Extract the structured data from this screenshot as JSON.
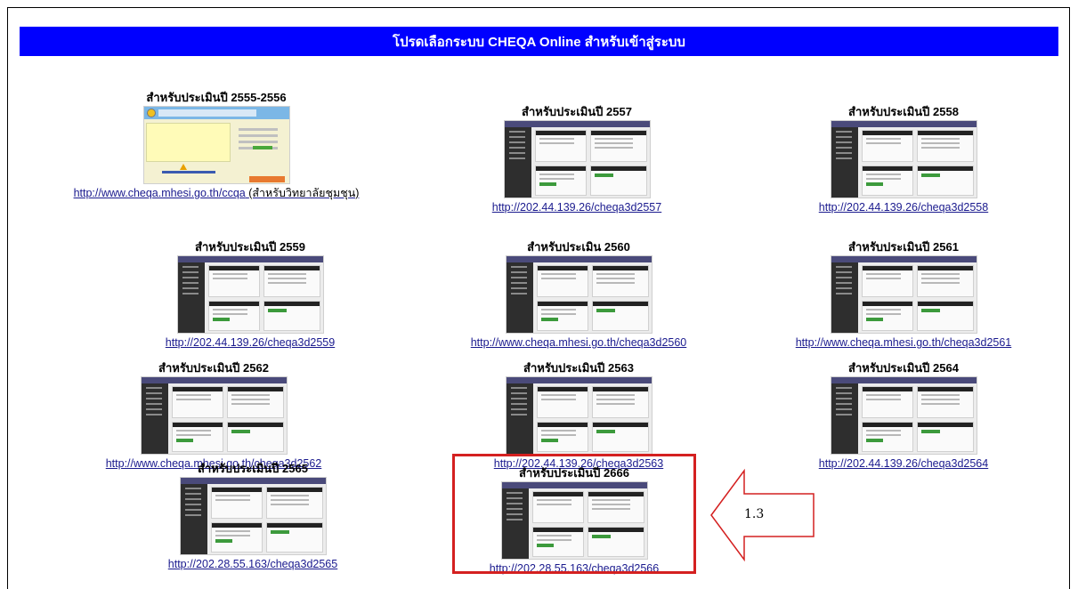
{
  "banner": {
    "text": "โปรดเลือกระบบ CHEQA Online สำหรับเข้าสู่ระบบ",
    "color": "#0000ff"
  },
  "items": [
    {
      "title": "สำหรับประเมินปี 2555-2556",
      "link": "http://www.cheqa.mhesi.go.th/ccqa",
      "link_suffix": "(สำหรับวิทยาลัยชุมชุน)"
    },
    {
      "title": "สำหรับประเมินปี 2557",
      "link": "http://202.44.139.26/cheqa3d2557"
    },
    {
      "title": "สำหรับประเมินปี 2558",
      "link": "http://202.44.139.26/cheqa3d2558"
    },
    {
      "title": "สำหรับประเมินปี 2559",
      "link": "http://202.44.139.26/cheqa3d2559"
    },
    {
      "title": "สำหรับประเมิน 2560",
      "link": "http://www.cheqa.mhesi.go.th/cheqa3d2560"
    },
    {
      "title": "สำหรับประเมินปี 2561",
      "link": "http://www.cheqa.mhesi.go.th/cheqa3d2561"
    },
    {
      "title": "สำหรับประเมินปี 2562",
      "link": "http://www.cheqa.mhesi.go.th/cheqa3d2562"
    },
    {
      "title": "สำหรับประเมินปี 2563",
      "link": "http://202.44.139.26/cheqa3d2563"
    },
    {
      "title": "สำหรับประเมินปี 2564",
      "link": "http://202.44.139.26/cheqa3d2564"
    },
    {
      "title": "สำหรับประเมินปี 2565",
      "link": "http://202.28.55.163/cheqa3d2565"
    },
    {
      "title": "สำหรับประเมินปี 2666",
      "link": "http://202.28.55.163/cheqa3d2566"
    }
  ],
  "annotation": {
    "label": "1.3",
    "color": "#d42020"
  },
  "icons": {
    "thumbnail": "screenshot-thumbnail",
    "callout": "left-arrow-callout"
  }
}
